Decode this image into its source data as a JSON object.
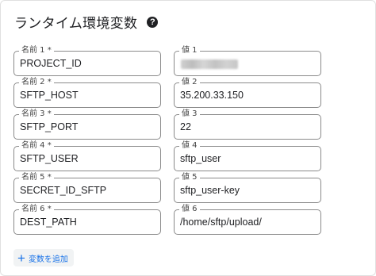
{
  "header": {
    "title": "ランタイム環境変数",
    "help_icon": "?"
  },
  "variables": [
    {
      "name_label": "名前 1 *",
      "name": "PROJECT_ID",
      "value_label": "値 1",
      "value": "",
      "value_redacted": true
    },
    {
      "name_label": "名前 2 *",
      "name": "SFTP_HOST",
      "value_label": "値 2",
      "value": "35.200.33.150"
    },
    {
      "name_label": "名前 3 *",
      "name": "SFTP_PORT",
      "value_label": "値 3",
      "value": "22"
    },
    {
      "name_label": "名前 4 *",
      "name": "SFTP_USER",
      "value_label": "値 4",
      "value": "sftp_user"
    },
    {
      "name_label": "名前 5 *",
      "name": "SECRET_ID_SFTP",
      "value_label": "値 5",
      "value": "sftp_user-key"
    },
    {
      "name_label": "名前 6 *",
      "name": "DEST_PATH",
      "value_label": "値 6",
      "value": "/home/sftp/upload/"
    }
  ],
  "add_button": {
    "icon": "+",
    "label": "変数を追加"
  },
  "colors": {
    "accent": "#1a73e8",
    "border": "#8a8a8a",
    "text": "#202124"
  }
}
